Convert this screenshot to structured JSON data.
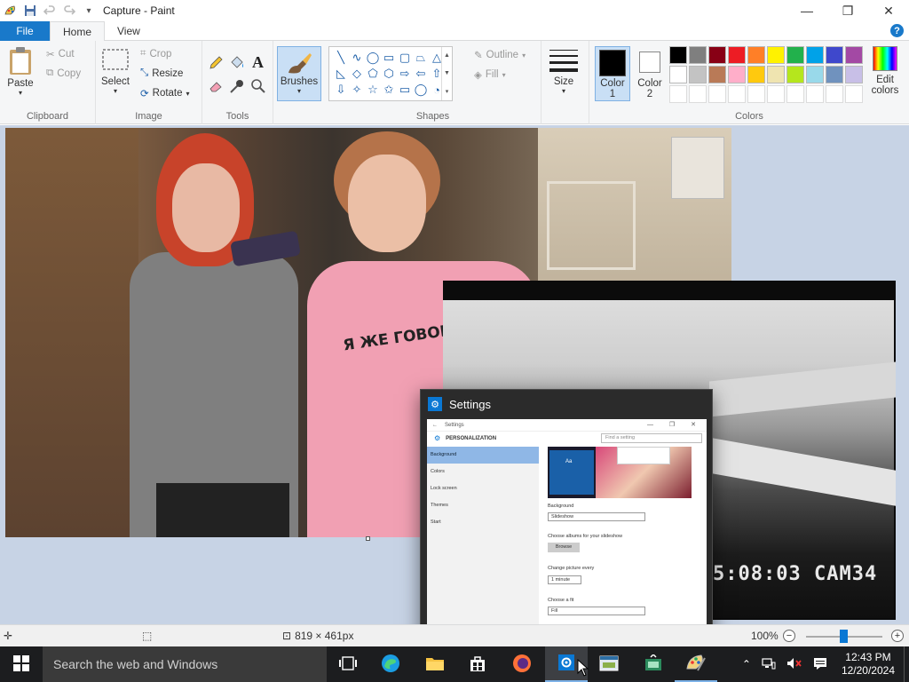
{
  "window": {
    "title": "Capture - Paint",
    "minimize": "—",
    "maximize": "❐",
    "close": "✕"
  },
  "tabs": [
    {
      "label": "File",
      "active": false
    },
    {
      "label": "Home",
      "active": true
    },
    {
      "label": "View",
      "active": false
    }
  ],
  "help": "?",
  "clipboard": {
    "paste": "Paste",
    "cut": "Cut",
    "copy": "Copy",
    "group": "Clipboard"
  },
  "image": {
    "select": "Select",
    "crop": "Crop",
    "resize": "Resize",
    "rotate": "Rotate",
    "group": "Image"
  },
  "tools": {
    "group": "Tools",
    "text_glyph": "A"
  },
  "brushes": {
    "label": "Brushes"
  },
  "shapes": {
    "outline": "Outline",
    "fill": "Fill",
    "group": "Shapes",
    "items": [
      "╲",
      "∿",
      "◯",
      "▭",
      "▢",
      "⏢",
      "△",
      "◺",
      "◇",
      "⬠",
      "⬡",
      "⇨",
      "⇦",
      "⇧",
      "⇩",
      "✧",
      "☆",
      "✩",
      "▭",
      "◯",
      "◔"
    ]
  },
  "size": {
    "label": "Size"
  },
  "colors": {
    "color1_label": "Color",
    "color1_num": "1",
    "color2_label": "Color",
    "color2_num": "2",
    "edit_label": "Edit",
    "edit_label2": "colors",
    "group": "Colors",
    "color1": "#000000",
    "color2": "#ffffff",
    "palette_row1": [
      "#000000",
      "#7f7f7f",
      "#880015",
      "#ed1c24",
      "#ff7f27",
      "#fff200",
      "#22b14c",
      "#00a2e8",
      "#3f48cc",
      "#a349a4"
    ],
    "palette_row2": [
      "#ffffff",
      "#c3c3c3",
      "#b97a57",
      "#ffaec9",
      "#ffc90e",
      "#efe4b0",
      "#b5e61d",
      "#99d9ea",
      "#7092be",
      "#c8bfe7"
    ]
  },
  "canvas": {
    "shirt_text": "Я ЖЕ ГОВОРИЛ",
    "cctv_stamp": "5:08:03 CAM34"
  },
  "settings_window": {
    "title": "Settings",
    "preview_title": "Settings",
    "section": "PERSONALIZATION",
    "search_placeholder": "Find a setting",
    "sidebar": [
      "Background",
      "Colors",
      "Lock screen",
      "Themes",
      "Start"
    ],
    "background_label": "Background",
    "background_value": "Slideshow",
    "albums_label": "Choose albums for your slideshow",
    "browse": "Browse",
    "change_label": "Change picture every",
    "change_value": "1 minute",
    "fit_label": "Choose a fit",
    "fit_value": "Fill",
    "tile_text": "Aa"
  },
  "statusbar": {
    "dimensions": "819 × 461px",
    "zoom": "100%"
  },
  "taskbar": {
    "search_placeholder": "Search the web and Windows",
    "time": "12:43 PM",
    "date": "12/20/2024"
  }
}
